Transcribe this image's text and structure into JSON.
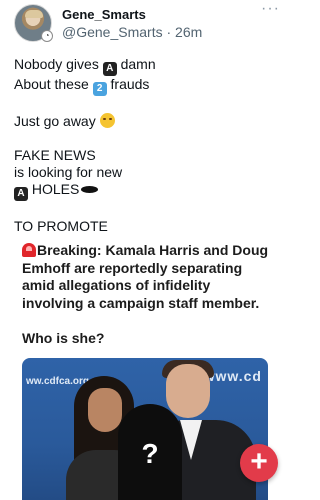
{
  "post": {
    "author_name": "Gene_Smarts",
    "handle": "@Gene_Smarts",
    "separator": " · ",
    "time": "26m",
    "more_label": "···",
    "lines": {
      "l1a": "Nobody gives ",
      "l1_box": "A",
      "l1b": " damn",
      "l2a": "About these ",
      "l2_box": "2",
      "l2b": " frauds",
      "l3": "Just go away ",
      "l4": "FAKE NEWS",
      "l5": "is looking for new",
      "l6_box": "A",
      "l6": " HOLES",
      "l7": "TO PROMOTE"
    },
    "emojis": {
      "box_letter": "negative-squared-a-icon",
      "box_number": "keycap-2-icon",
      "face": "disappointed-relieved-face-icon",
      "hole": "hole-icon",
      "siren": "police-light-icon"
    }
  },
  "quote": {
    "headline": "Breaking: Kamala Harris and Doug Emhoff are reportedly separating amid allegations of infidelity involving a campaign staff member.",
    "question": "Who is she?"
  },
  "image": {
    "banner_left": "ww.cdfca.org",
    "banner_right": "www.cd",
    "silhouette_mark": "?"
  },
  "fab": {
    "label": "+",
    "icon": "compose-plus-icon",
    "color": "#e23b4a"
  },
  "colors": {
    "text": "#0f1419",
    "secondary": "#536471",
    "photo_blue": "#2f63a8"
  }
}
